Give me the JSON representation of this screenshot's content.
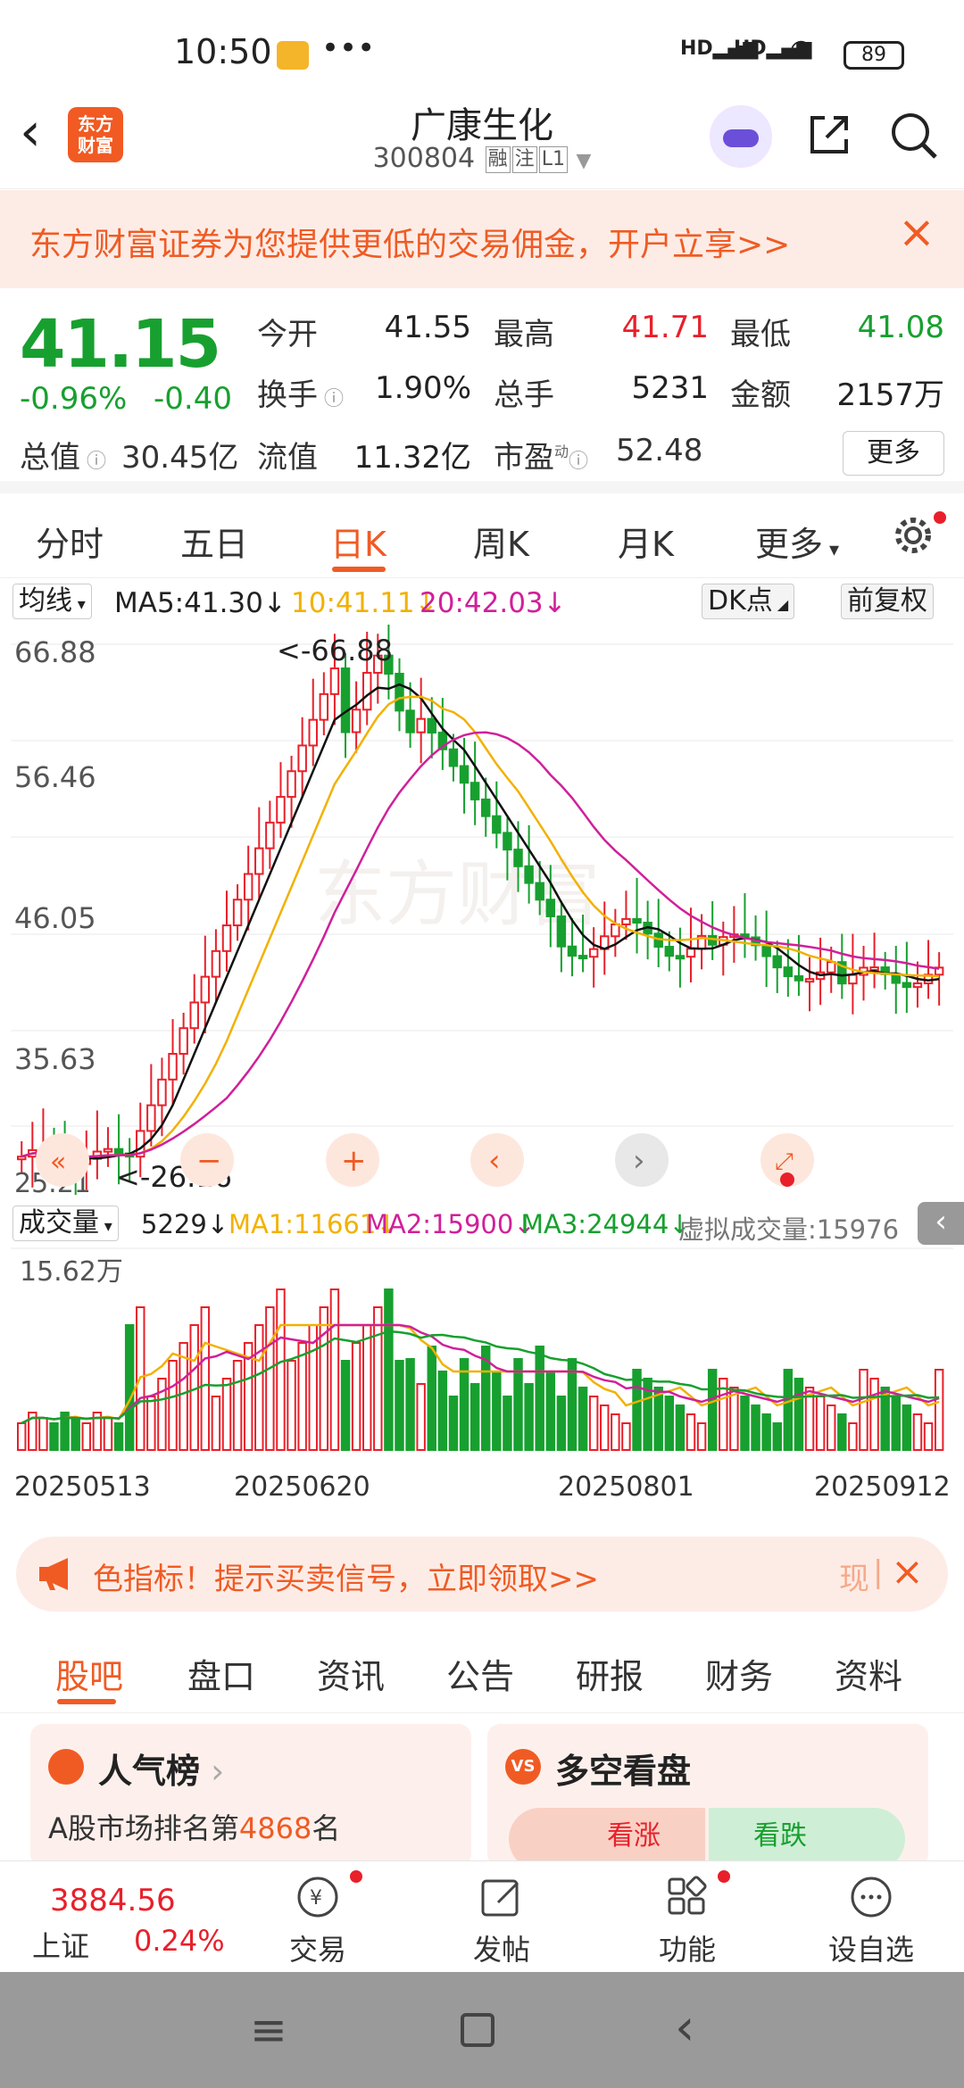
{
  "status": {
    "time": "10:50",
    "battery": "89"
  },
  "header": {
    "logo_text": "东方财富",
    "title": "广康生化",
    "code": "300804",
    "tags": [
      "融",
      "注",
      "L1"
    ]
  },
  "banner": {
    "text": "东方财富证券为您提供更低的交易佣金，开户立享>>"
  },
  "quote": {
    "price": "41.15",
    "change_pct": "-0.96%",
    "change": "-0.40",
    "rows": [
      [
        {
          "label": "今开",
          "value": "41.55",
          "color": "#222"
        },
        {
          "label": "最高",
          "value": "41.71",
          "color": "#e8202a"
        },
        {
          "label": "最低",
          "value": "41.08",
          "color": "#17a02f"
        }
      ],
      [
        {
          "label": "换手",
          "value": "1.90%",
          "color": "#222"
        },
        {
          "label": "总手",
          "value": "5231",
          "color": "#222"
        },
        {
          "label": "金额",
          "value": "2157万",
          "color": "#222"
        }
      ]
    ],
    "total_value_label": "总值",
    "total_value": "30.45亿",
    "float_value_label": "流值",
    "float_value": "11.32亿",
    "pe_label": "市盈",
    "pe_sup": "动",
    "pe_value": "52.48",
    "more": "更多"
  },
  "ktabs": [
    "分时",
    "五日",
    "日K",
    "周K",
    "月K",
    "更多"
  ],
  "ma_bar": {
    "selector": "均线",
    "ma5": "MA5:41.30",
    "ma10": "10:41.11",
    "ma20": "20:42.03",
    "dk": "DK点",
    "fq": "前复权"
  },
  "kchart": {
    "y_labels": [
      "66.88",
      "56.46",
      "46.05",
      "35.63",
      "25.21"
    ],
    "high_note": "<-66.88",
    "low_note": "<-26.16"
  },
  "vol_bar": {
    "selector": "成交量",
    "vol": "5229",
    "ma1": "MA1:11661",
    "ma2": "MA2:15900",
    "ma3": "MA3:24944",
    "virtual": "虚拟成交量:15976"
  },
  "vchart": {
    "max_label": "15.62万"
  },
  "dates": [
    "20250513",
    "20250620",
    "20250801",
    "20250912"
  ],
  "promo": {
    "text": "色指标！提示买卖信号，立即领取>>",
    "side": "现"
  },
  "btabs": [
    "股吧",
    "盘口",
    "资讯",
    "公告",
    "研报",
    "财务",
    "资料"
  ],
  "cards": {
    "popular_title": "人气榜",
    "rank_text_pre": "A股市场排名第",
    "rank": "4868",
    "rank_text_post": "名",
    "longshort_title": "多空看盘",
    "bull": "看涨",
    "bear": "看跌"
  },
  "bottom": {
    "index_value": "3884.56",
    "index_name": "上证",
    "index_pct": "0.24%",
    "items": [
      "交易",
      "发帖",
      "功能",
      "设自选"
    ]
  },
  "colors": {
    "accent": "#f05b24",
    "up": "#e8202a",
    "down": "#17a02f",
    "ma5": "#111111",
    "ma10": "#f2b100",
    "ma20": "#d0209a"
  }
}
